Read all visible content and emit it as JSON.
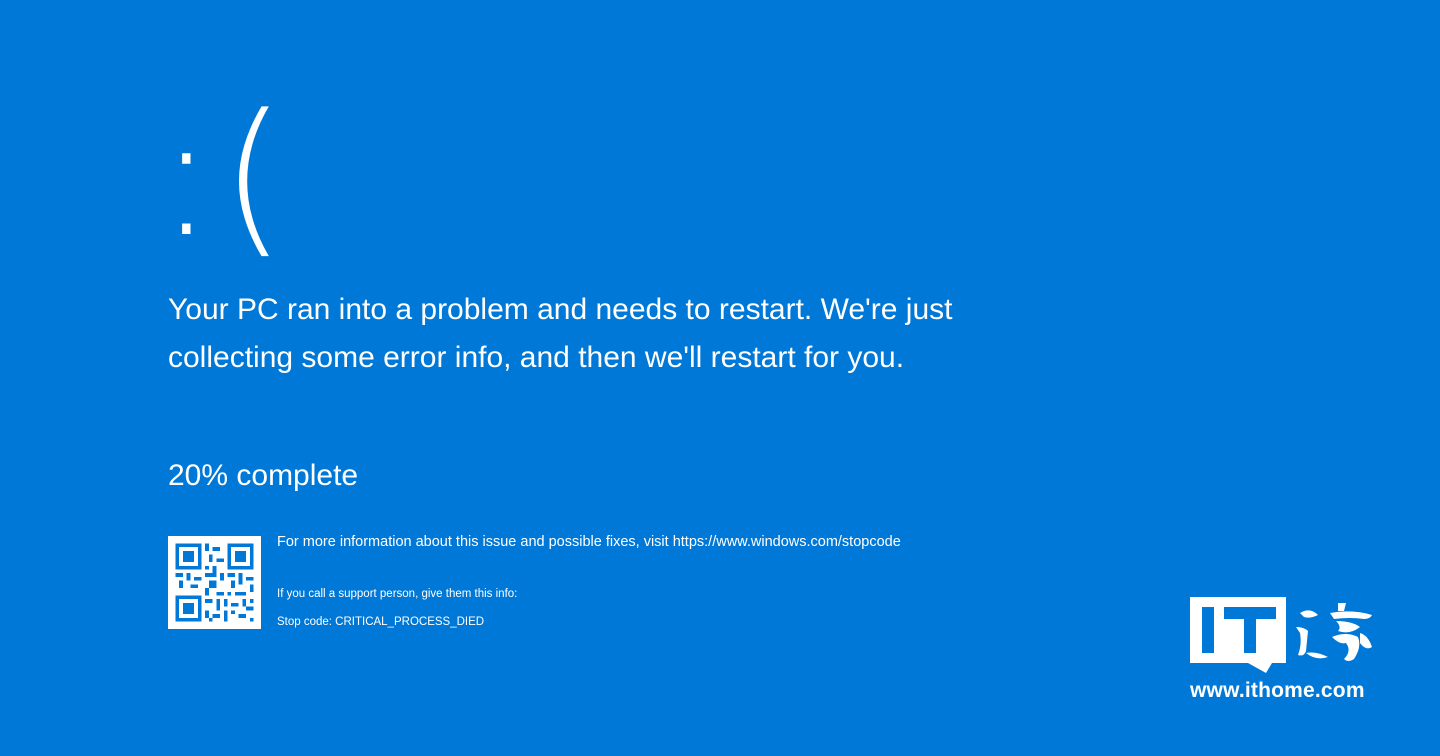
{
  "screen": {
    "background_color": "#0078d7",
    "text_color": "#ffffff",
    "sad_face": ":(",
    "message": "Your PC ran into a problem and needs to restart. We're just collecting some error info, and then we'll restart for you.",
    "progress_text": "20% complete",
    "progress_percent": 20,
    "more_info": "For more information about this issue and possible fixes, visit https://www.windows.com/stopcode",
    "support_line": "If you call a support person, give them this info:",
    "stop_code": "Stop code: CRITICAL_PROCESS_DIED",
    "qr_icon": "qr-code-icon"
  },
  "watermark": {
    "logo_text": "IT之家",
    "url": "www.ithome.com"
  }
}
